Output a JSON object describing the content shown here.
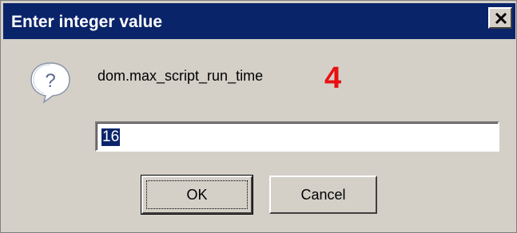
{
  "dialog": {
    "title": "Enter integer value",
    "close_icon": "close-icon",
    "message_icon": "question-icon",
    "setting_name": "dom.max_script_run_time",
    "annotation": "4",
    "annotation_color": "#e81010",
    "input": {
      "value": "16",
      "selected": true
    },
    "buttons": {
      "ok_label": "OK",
      "cancel_label": "Cancel"
    },
    "title_bar_color": "#0a246a"
  }
}
